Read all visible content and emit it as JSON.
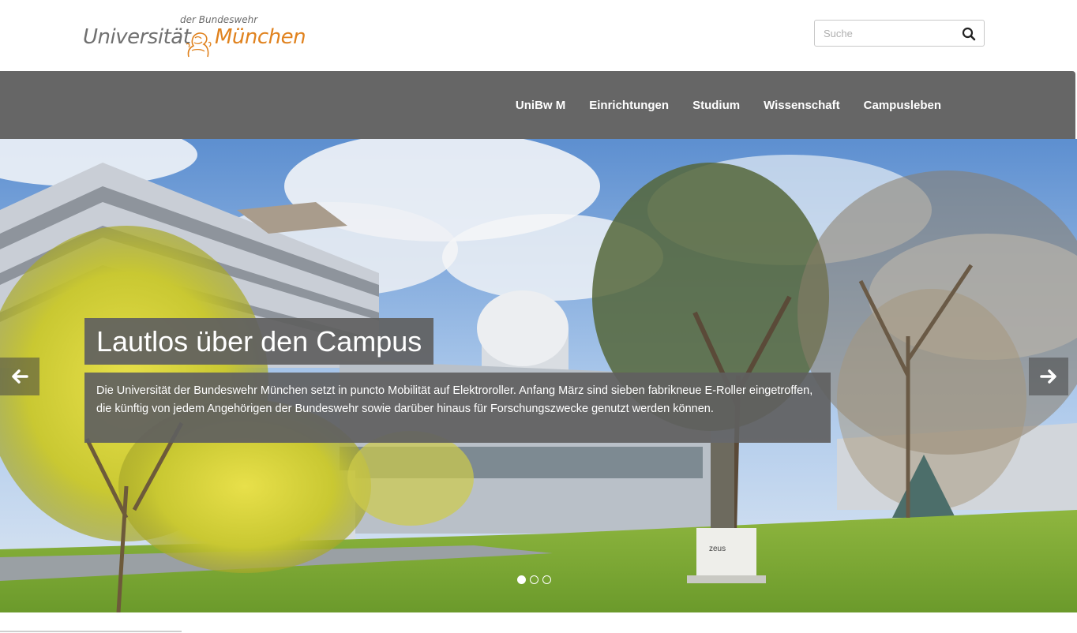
{
  "header": {
    "logo": {
      "small_text": "der Bundeswehr",
      "left_text": "Universität",
      "right_text": "München"
    },
    "search": {
      "placeholder": "Suche"
    }
  },
  "nav": {
    "items": [
      {
        "label": "UniBw M"
      },
      {
        "label": "Einrichtungen"
      },
      {
        "label": "Studium"
      },
      {
        "label": "Wissenschaft"
      },
      {
        "label": "Campusleben"
      }
    ]
  },
  "hero": {
    "title": "Lautlos über den Campus",
    "text": "Die Universität der Bundeswehr München setzt in puncto Mobilität auf Elektroroller. Anfang März sind sieben fabrikneue E-Roller eingetroffen, die künftig von jedem Angehörigen der Bundeswehr sowie darüber hinaus für Forschungszwecke genutzt werden können.",
    "slide_count": 3,
    "active_slide": 1,
    "sign_text": "zeus"
  },
  "colors": {
    "nav_bg": "#666666",
    "logo_orange": "#e0821e",
    "logo_grey": "#707070",
    "caption_bg": "#5f5f5f"
  },
  "icons": {
    "search": "search-icon",
    "prev": "arrow-left-icon",
    "next": "arrow-right-icon",
    "emblem": "lion-emblem-icon"
  }
}
